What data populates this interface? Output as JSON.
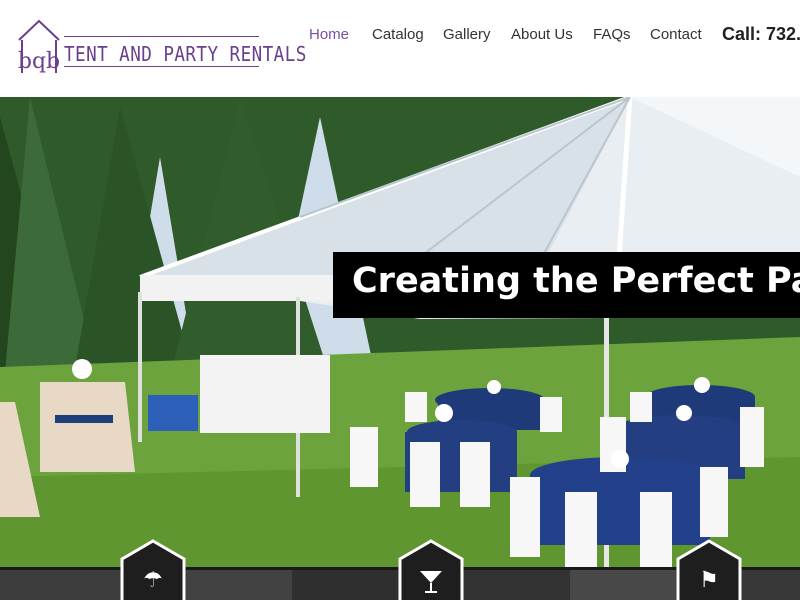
{
  "header": {
    "logo": {
      "monogram": "bqb",
      "text": "TENT AND PARTY RENTALS"
    },
    "nav": [
      {
        "label": "Home",
        "active": true
      },
      {
        "label": "Catalog",
        "active": false
      },
      {
        "label": "Gallery",
        "active": false
      },
      {
        "label": "About Us",
        "active": false
      },
      {
        "label": "FAQs",
        "active": false
      },
      {
        "label": "Contact",
        "active": false
      }
    ],
    "call": "Call: 732."
  },
  "hero": {
    "banner": "Creating the Perfect Pa"
  },
  "features": [
    {
      "icon": "umbrella-icon",
      "glyph": "☂"
    },
    {
      "icon": "cocktail-glass-icon",
      "glyph": "🍸"
    },
    {
      "icon": "flag-icon",
      "glyph": "⚑"
    }
  ],
  "colors": {
    "brand_purple": "#6a3f8e",
    "nav_active": "#7c4e9e",
    "banner_bg": "#000000",
    "bottom_bar": "#3a3a3a"
  }
}
